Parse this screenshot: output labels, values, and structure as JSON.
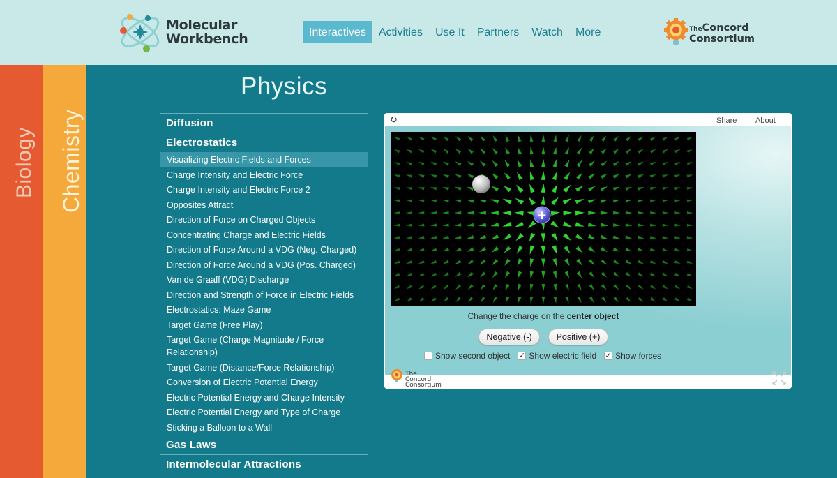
{
  "header": {
    "logo_line1": "Molecular",
    "logo_line2": "Workbench",
    "nav": [
      {
        "label": "Interactives",
        "active": true
      },
      {
        "label": "Activities"
      },
      {
        "label": "Use It"
      },
      {
        "label": "Partners"
      },
      {
        "label": "Watch"
      },
      {
        "label": "More"
      }
    ],
    "partner_logo": {
      "the": "The",
      "line1": "Concord",
      "line2": "Consortium"
    }
  },
  "side_tabs": {
    "biology": "Biology",
    "chemistry": "Chemistry"
  },
  "page_title": "Physics",
  "list": {
    "diffusion": "Diffusion",
    "electrostatics": "Electrostatics",
    "items": [
      "Visualizing Electric Fields and Forces",
      "Charge Intensity and Electric Force",
      "Charge Intensity and Electric Force 2",
      "Opposites Attract",
      "Direction of Force on Charged Objects",
      "Concentrating Charge and Electric Fields",
      "Direction of Force Around a VDG (Neg. Charged)",
      "Direction of Force Around a VDG (Pos. Charged)",
      "Van de Graaff (VDG) Discharge",
      "Direction and Strength of Force in Electric Fields",
      "Electrostatics: Maze Game",
      "Target Game (Free Play)",
      "Target Game (Charge Magnitude / Force Relationship)",
      "Target Game (Distance/Force Relationship)",
      "Conversion of Electric Potential Energy",
      "Electric Potential Energy and Charge Intensity",
      "Electric Potential Energy and Type of Charge",
      "Sticking a Balloon to a Wall"
    ],
    "active_index": 0,
    "gas_laws": "Gas Laws",
    "intermolecular": "Intermolecular Attractions"
  },
  "interactive": {
    "reload_icon": "reload-icon",
    "share": "Share",
    "about": "About",
    "caption_prefix": "Change the charge on the ",
    "caption_bold": "center object",
    "negative_button": "Negative (-)",
    "positive_button": "Positive (+)",
    "checkboxes": [
      {
        "label": "Show second object",
        "checked": false
      },
      {
        "label": "Show electric field",
        "checked": true
      },
      {
        "label": "Show forces",
        "checked": true
      }
    ],
    "footer_logo": {
      "line1": "The Concord",
      "line2": "Consortium"
    },
    "center_charge_symbol": "+",
    "field_color": "#2fd62f"
  }
}
